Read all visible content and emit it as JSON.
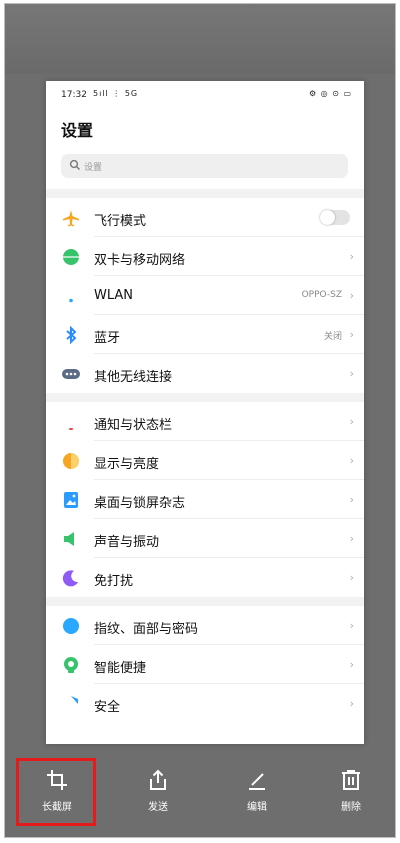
{
  "status_bar": {
    "time": "17:32",
    "left_icons": "5ıll ⋮ 5G",
    "right_icons": "⚙ ◎ ⊙ ▭"
  },
  "page_title": "设置",
  "search": {
    "placeholder": "设置",
    "icon": "search-icon"
  },
  "groups": [
    [
      {
        "label": "飞行模式",
        "icon": "airplane-icon",
        "color": "#f5a623",
        "toggle": true
      },
      {
        "label": "双卡与移动网络",
        "icon": "globe-icon",
        "color": "#36c36b"
      },
      {
        "label": "WLAN",
        "icon": "wifi-icon",
        "color": "#2aa7ff",
        "value": "OPPO-SZ"
      },
      {
        "label": "蓝牙",
        "icon": "bluetooth-icon",
        "color": "#2a8cff",
        "value": "关闭"
      },
      {
        "label": "其他无线连接",
        "icon": "more-connections-icon",
        "color": "#5a6b86"
      }
    ],
    [
      {
        "label": "通知与状态栏",
        "icon": "bell-icon",
        "color": "#f04848"
      },
      {
        "label": "显示与亮度",
        "icon": "brightness-icon",
        "color": "#f5a623"
      },
      {
        "label": "桌面与锁屏杂志",
        "icon": "wallpaper-icon",
        "color": "#2a9cff"
      },
      {
        "label": "声音与振动",
        "icon": "speaker-icon",
        "color": "#36c36b"
      },
      {
        "label": "免打扰",
        "icon": "moon-icon",
        "color": "#8e5cf5"
      }
    ],
    [
      {
        "label": "指纹、面部与密码",
        "icon": "fingerprint-icon",
        "color": "#2aa7ff"
      },
      {
        "label": "智能便捷",
        "icon": "smart-icon",
        "color": "#36c36b"
      },
      {
        "label": "安全",
        "icon": "shield-icon",
        "color": "#2a9cff"
      }
    ]
  ],
  "toolbar": [
    {
      "label": "长截屏",
      "icon": "crop-icon"
    },
    {
      "label": "发送",
      "icon": "share-icon"
    },
    {
      "label": "编辑",
      "icon": "edit-icon"
    },
    {
      "label": "删除",
      "icon": "trash-icon"
    }
  ]
}
